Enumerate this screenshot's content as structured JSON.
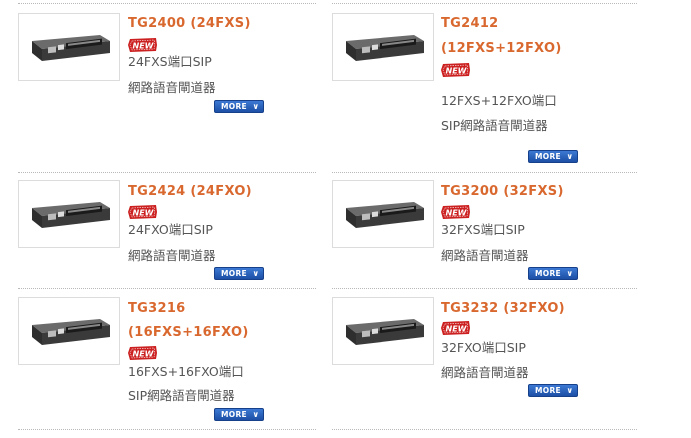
{
  "new_badge": "NEW",
  "more_label": "MORE",
  "products": [
    {
      "title1": "TG2400 (24FXS)",
      "title2": "",
      "desc1": "24FXS端口SIP",
      "desc2": "網路語音閘道器"
    },
    {
      "title1": "TG2412",
      "title2": "(12FXS+12FXO)",
      "desc1": "12FXS+12FXO端口",
      "desc2": "SIP網路語音閘道器"
    },
    {
      "title1": "TG2424 (24FXO)",
      "title2": "",
      "desc1": "24FXO端口SIP",
      "desc2": "網路語音閘道器"
    },
    {
      "title1": "TG3200 (32FXS)",
      "title2": "",
      "desc1": "32FXS端口SIP",
      "desc2": "網路語音閘道器"
    },
    {
      "title1": "TG3216",
      "title2": "(16FXS+16FXO)",
      "desc1": "16FXS+16FXO端口",
      "desc2": "SIP網路語音閘道器"
    },
    {
      "title1": "TG3232 (32FXO)",
      "title2": "",
      "desc1": "32FXO端口SIP",
      "desc2": "網路語音閘道器"
    }
  ],
  "colors": {
    "title": "#d9682f",
    "badge": "#cc1f1f",
    "button": "#2a5fb8",
    "desc": "#555555"
  }
}
